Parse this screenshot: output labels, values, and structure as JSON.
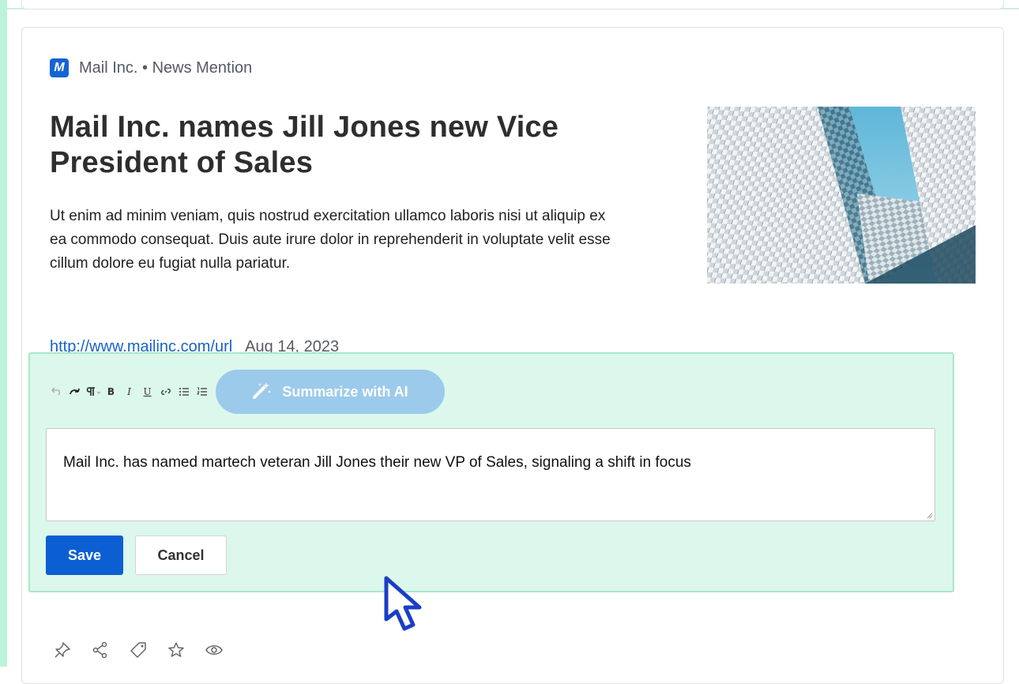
{
  "article": {
    "source_logo_letter": "M",
    "source_line": "Mail Inc. • News Mention",
    "headline": "Mail Inc. names Jill Jones new Vice President of Sales",
    "body": "Ut enim ad minim veniam, quis nostrud exercitation ullamco laboris nisi ut aliquip ex ea commodo consequat. Duis aute irure dolor in reprehenderit in voluptate velit esse cillum dolore eu fugiat nulla pariatur.",
    "url": "http://www.mailinc.com/url",
    "date": "Aug 14, 2023"
  },
  "editor": {
    "toolbar": {
      "icons": [
        "undo-icon",
        "redo-icon",
        "paragraph-icon",
        "bold-icon",
        "italic-icon",
        "underline-icon",
        "link-icon",
        "bullet-list-icon",
        "numbered-list-icon"
      ],
      "bold_glyph": "B",
      "italic_glyph": "I",
      "underline_glyph": "U",
      "ai_button_label": "Summarize with AI"
    },
    "note_text": "Mail Inc. has named martech veteran Jill Jones their new VP of Sales, signaling a shift in focus",
    "save_label": "Save",
    "cancel_label": "Cancel"
  },
  "actions": [
    "pin-icon",
    "share-icon",
    "tag-icon",
    "star-icon",
    "eye-icon"
  ],
  "colors": {
    "accent": "#0b5fd3",
    "editor_bg": "#dcf7ec",
    "editor_border": "#a6e8c8",
    "ai_button": "#9ccaeb",
    "link": "#1763c8",
    "side_strip": "#bdf2da"
  }
}
